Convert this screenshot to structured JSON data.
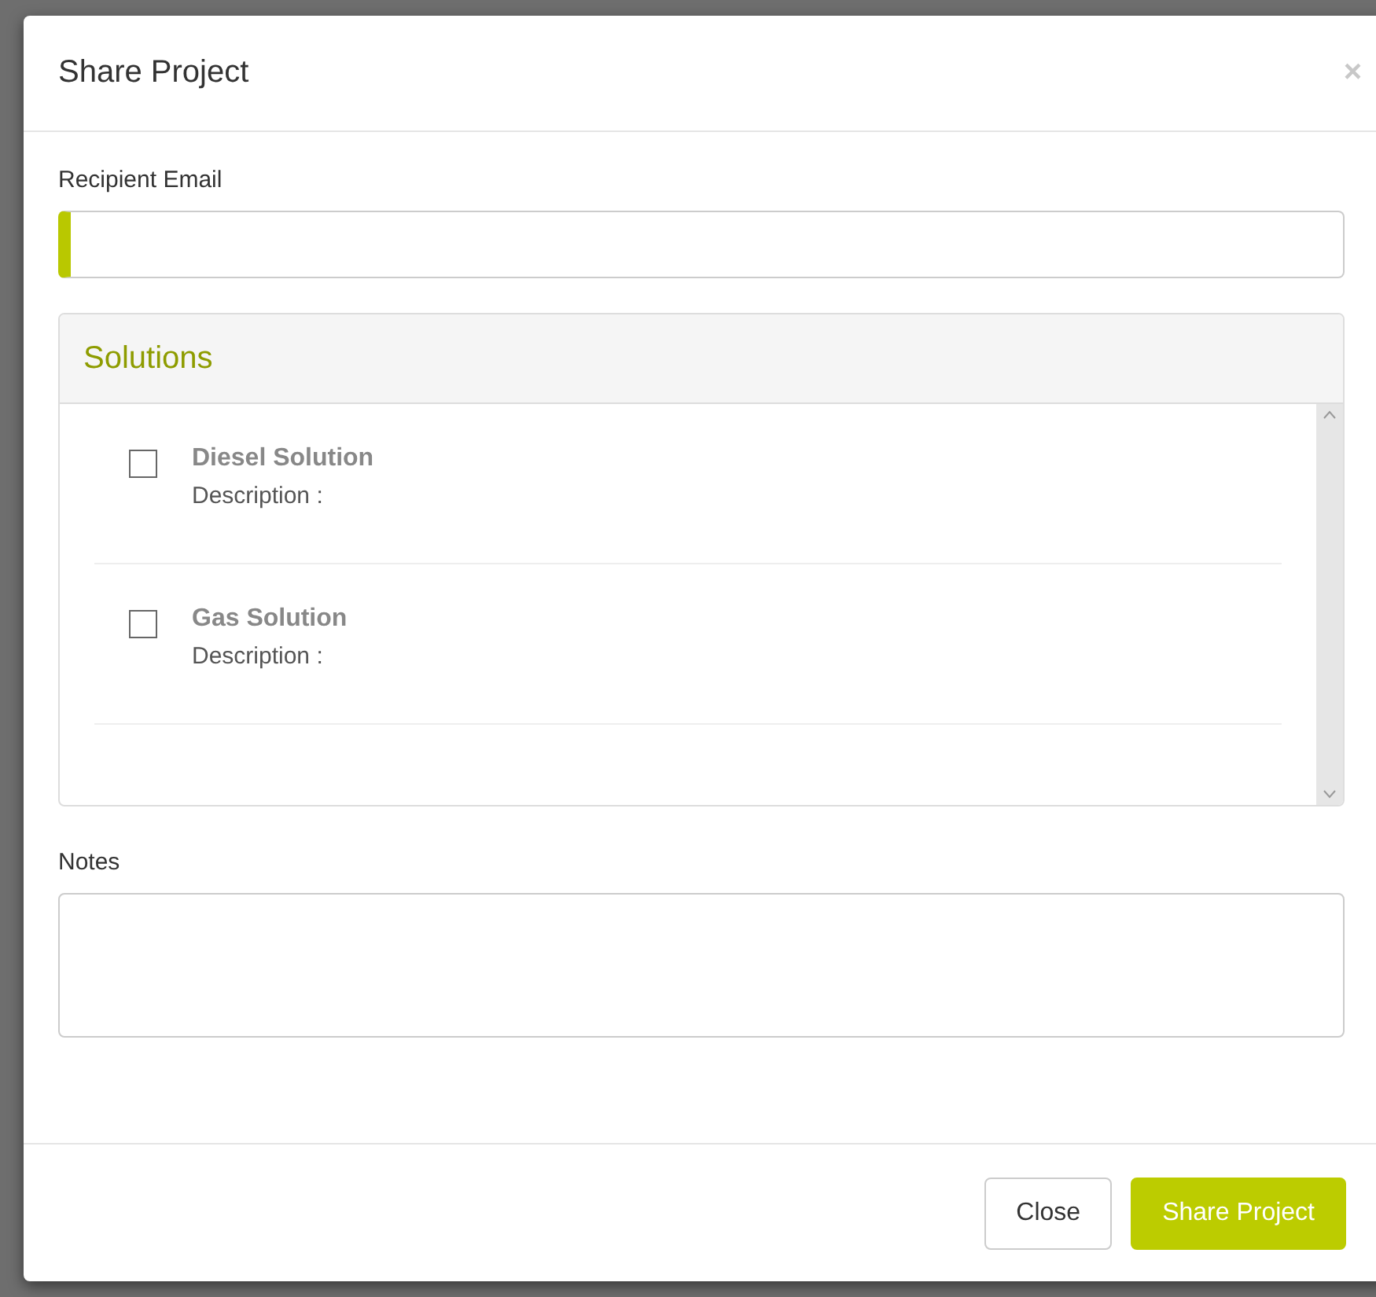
{
  "dialog": {
    "title": "Share Project",
    "close_icon": "×"
  },
  "recipient_email": {
    "label": "Recipient Email"
  },
  "solutions": {
    "title": "Solutions",
    "items": [
      {
        "name": "Diesel Solution",
        "description": "Description :",
        "checked": false
      },
      {
        "name": "Gas Solution",
        "description": "Description :",
        "checked": false
      }
    ]
  },
  "notes": {
    "label": "Notes"
  },
  "buttons": [
    {
      "label": "Close",
      "kind": "default"
    },
    {
      "label": "Share Project",
      "kind": "primary"
    }
  ]
}
